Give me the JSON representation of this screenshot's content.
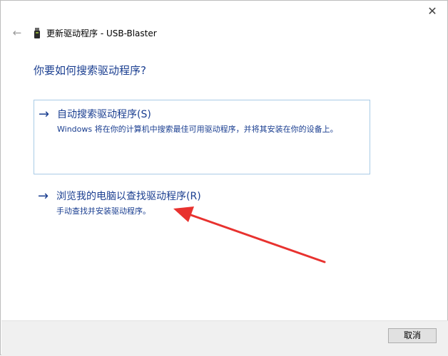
{
  "window": {
    "title": "更新驱动程序 - USB-Blaster",
    "close_glyph": "✕",
    "back_glyph": "←"
  },
  "heading": "你要如何搜索驱动程序?",
  "options": [
    {
      "arrow": "→",
      "title": "自动搜索驱动程序(S)",
      "description": "Windows 将在你的计算机中搜索最佳可用驱动程序，并将其安装在你的设备上。"
    },
    {
      "arrow": "→",
      "title": "浏览我的电脑以查找驱动程序(R)",
      "description": "手动查找并安装驱动程序。"
    }
  ],
  "footer": {
    "cancel_label": "取消"
  },
  "colors": {
    "accent": "#1a3e90",
    "option_border": "#a9cbe6",
    "annotation_arrow": "#e8322f",
    "footer_bg": "#f0f0f0"
  },
  "icons": {
    "close": "close-icon",
    "back": "back-arrow-icon",
    "device": "usb-device-icon"
  }
}
